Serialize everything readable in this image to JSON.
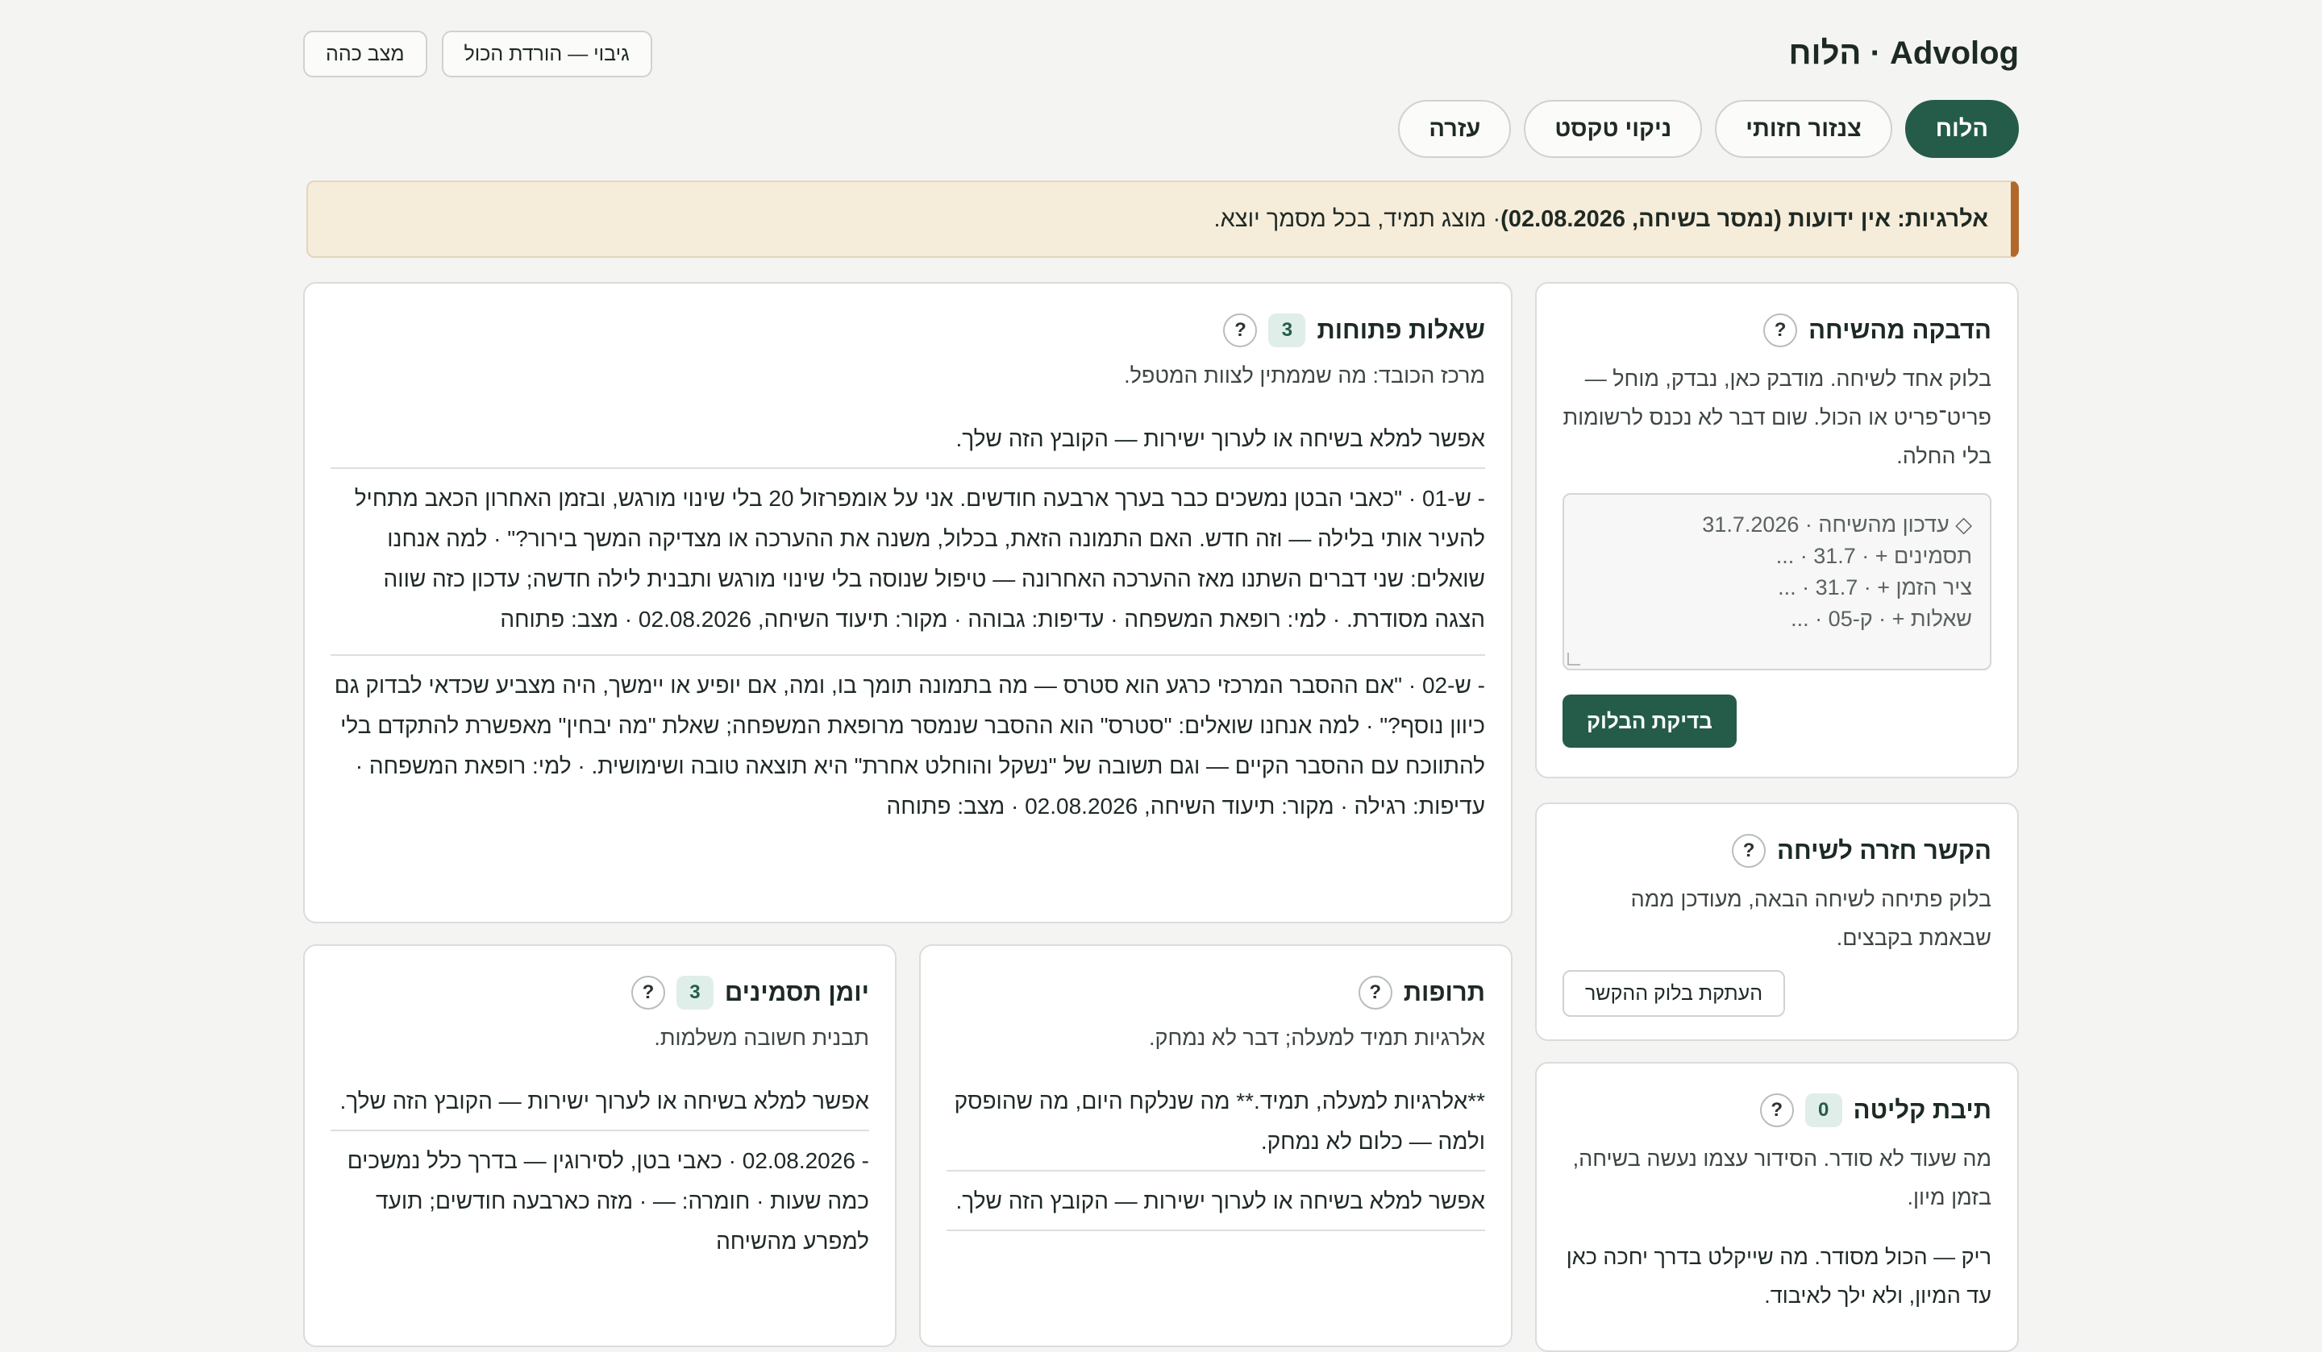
{
  "app": {
    "title": "Advolog · הלוח"
  },
  "top_actions": {
    "status_label": "מצב כהה",
    "backup_label": "גיבוי — הורדת הכול"
  },
  "tabs": [
    {
      "label": "הלוח",
      "active": true
    },
    {
      "label": "צנזור חזותי",
      "active": false
    },
    {
      "label": "ניקוי טקסט",
      "active": false
    },
    {
      "label": "עזרה",
      "active": false
    }
  ],
  "alert": {
    "strong": "אלרגיות: אין ידועות (נמסר בשיחה, 02.08.2026)",
    "rest": " · מוצג תמיד, בכל מסמך יוצא."
  },
  "paste": {
    "title": "הדבקה מהשיחה",
    "help": "?",
    "description": "בלוק אחד לשיחה. מודבק כאן, נבדק, מוחל — פריט־פריט או הכול. שום דבר לא נכנס לרשומות בלי החלה.",
    "lines": [
      "◇ עדכון מהשיחה · 31.7.2026",
      "תסמינים + · 31.7 · ...",
      "ציר הזמן + · 31.7 · ...",
      "שאלות + · ק-05 · ..."
    ],
    "check_label": "בדיקת הבלוק"
  },
  "return_link": {
    "title": "הקשר חזרה לשיחה",
    "help": "?",
    "description": "בלוק פתיחה לשיחה הבאה, מעודכן ממה שבאמת בקבצים.",
    "copy_label": "העתקת בלוק ההקשר"
  },
  "inbox": {
    "title": "תיבת קליטה",
    "count": "0",
    "help": "?",
    "description": "מה שעוד לא סודר. הסידור עצמו נעשה בשיחה, בזמן מיון.",
    "empty_text": "ריק — הכול מסודר. מה שייקלט בדרך יחכה כאן עד המיון, ולא ילך לאיבוד."
  },
  "questions": {
    "title": "שאלות פתוחות",
    "count": "3",
    "help": "?",
    "focus": "מרכז הכובד: מה שממתין לצוות המטפל.",
    "fill_note": "אפשר למלא בשיחה או לערוך ישירות — הקובץ הזה שלך.",
    "items": [
      "- ש-01 · \"כאבי הבטן נמשכים כבר בערך ארבעה חודשים. אני על אומפרזול 20 בלי שינוי מורגש, ובזמן האחרון הכאב מתחיל להעיר אותי בלילה — וזה חדש. האם התמונה הזאת, בכלול, משנה את ההערכה או מצדיקה המשך בירור?\" · למה אנחנו שואלים: שני דברים השתנו מאז ההערכה האחרונה — טיפול שנוסה בלי שינוי מורגש ותבנית לילה חדשה; עדכון כזה שווה הצגה מסודרת. · למי: רופאת המשפחה · עדיפות: גבוהה · מקור: תיעוד השיחה, 02.08.2026 · מצב: פתוחה",
      "- ש-02 · \"אם ההסבר המרכזי כרגע הוא סטרס — מה בתמונה תומך בו, ומה, אם יופיע או יימשך, היה מצביע שכדאי לבדוק גם כיוון נוסף?\" · למה אנחנו שואלים: \"סטרס\" הוא ההסבר שנמסר מרופאת המשפחה; שאלת \"מה יבחין\" מאפשרת להתקדם בלי להתווכח עם ההסבר הקיים — וגם תשובה של \"נשקל והוחלט אחרת\" היא תוצאה טובה ושימושית. · למי: רופאת המשפחה · עדיפות: רגילה · מקור: תיעוד השיחה, 02.08.2026 · מצב: פתוחה"
    ]
  },
  "meds": {
    "title": "תרופות",
    "help": "?",
    "description": "אלרגיות תמיד למעלה; דבר לא נמחק.",
    "item": "**אלרגיות למעלה, תמיד.** מה שנלקח היום, מה שהופסק ולמה — כלום לא נמחק.",
    "fill_note": "אפשר למלא בשיחה או לערוך ישירות — הקובץ הזה שלך."
  },
  "symptoms": {
    "title": "יומן תסמינים",
    "count": "3",
    "help": "?",
    "description": "תבנית חשובה משלמות.",
    "fill_note": "אפשר למלא בשיחה או לערוך ישירות — הקובץ הזה שלך.",
    "item": "- 02.08.2026 · כאבי בטן, לסירוגין — בדרך כלל נמשכים כמה שעות · חומרה: — · מזה כארבעה חודשים; תועד למפרע מהשיחה"
  }
}
